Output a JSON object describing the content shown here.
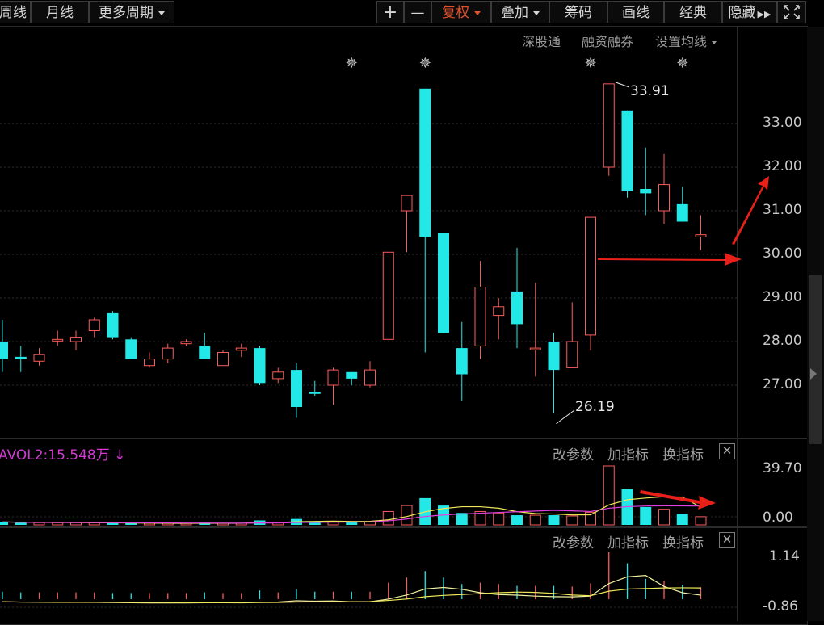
{
  "toolbar": {
    "left_tabs": [
      "周线",
      "月线",
      "更多周期"
    ],
    "zoom_in": "+",
    "zoom_out": "—",
    "buttons": [
      "复权",
      "叠加",
      "筹码",
      "画线",
      "经典",
      "隐藏"
    ]
  },
  "subnav": {
    "items": [
      "深股通",
      "融资融券",
      "设置均线"
    ]
  },
  "price_axis": {
    "ticks": [
      "33.00",
      "32.00",
      "31.00",
      "30.00",
      "29.00",
      "28.00",
      "27.00"
    ]
  },
  "annotations": {
    "high": "33.91",
    "low": "26.19"
  },
  "volume_panel": {
    "label": "AVOL2:15.548万",
    "arrow": "↓",
    "actions": [
      "改参数",
      "加指标",
      "换指标"
    ],
    "close": "✕",
    "axis": [
      "39.70",
      "0.00"
    ]
  },
  "indicator_panel": {
    "actions": [
      "改参数",
      "加指标",
      "换指标"
    ],
    "close": "✕",
    "axis": [
      "1.14",
      "-0.86"
    ]
  },
  "colors": {
    "up": "#ff5a5a",
    "down": "#22e8e8",
    "arrow": "#e8201a",
    "vol_line": "#f0e85a",
    "vol_line2": "#e040e0"
  },
  "chart_data": {
    "type": "candlestick",
    "price_range": [
      26.0,
      34.0
    ],
    "markers": [
      19,
      23,
      32,
      37
    ],
    "candles": [
      {
        "o": 28.0,
        "h": 28.5,
        "l": 27.3,
        "c": 27.6
      },
      {
        "o": 27.65,
        "h": 27.9,
        "l": 27.3,
        "c": 27.6
      },
      {
        "o": 27.55,
        "h": 27.85,
        "l": 27.45,
        "c": 27.7
      },
      {
        "o": 28.05,
        "h": 28.25,
        "l": 27.9,
        "c": 28.05
      },
      {
        "o": 28.0,
        "h": 28.25,
        "l": 27.8,
        "c": 28.1
      },
      {
        "o": 28.25,
        "h": 28.55,
        "l": 28.1,
        "c": 28.5
      },
      {
        "o": 28.65,
        "h": 28.7,
        "l": 28.05,
        "c": 28.1
      },
      {
        "o": 28.05,
        "h": 28.1,
        "l": 27.6,
        "c": 27.6
      },
      {
        "o": 27.45,
        "h": 27.75,
        "l": 27.4,
        "c": 27.6
      },
      {
        "o": 27.6,
        "h": 27.95,
        "l": 27.5,
        "c": 27.85
      },
      {
        "o": 27.95,
        "h": 28.05,
        "l": 27.9,
        "c": 28.0
      },
      {
        "o": 27.9,
        "h": 28.2,
        "l": 27.6,
        "c": 27.6
      },
      {
        "o": 27.45,
        "h": 27.8,
        "l": 27.45,
        "c": 27.75
      },
      {
        "o": 27.8,
        "h": 27.95,
        "l": 27.65,
        "c": 27.85
      },
      {
        "o": 27.85,
        "h": 27.9,
        "l": 27.0,
        "c": 27.05
      },
      {
        "o": 27.15,
        "h": 27.4,
        "l": 27.05,
        "c": 27.3
      },
      {
        "o": 27.35,
        "h": 27.5,
        "l": 26.25,
        "c": 26.5
      },
      {
        "o": 26.85,
        "h": 27.1,
        "l": 26.75,
        "c": 26.8
      },
      {
        "o": 27.0,
        "h": 27.4,
        "l": 26.55,
        "c": 27.35
      },
      {
        "o": 27.3,
        "h": 27.3,
        "l": 27.0,
        "c": 27.15
      },
      {
        "o": 27.0,
        "h": 27.55,
        "l": 26.95,
        "c": 27.35
      },
      {
        "o": 28.05,
        "h": 30.05,
        "l": 28.05,
        "c": 30.05
      },
      {
        "o": 31.0,
        "h": 31.35,
        "l": 30.05,
        "c": 31.35
      },
      {
        "o": 33.8,
        "h": 33.8,
        "l": 27.75,
        "c": 30.4
      },
      {
        "o": 30.5,
        "h": 30.5,
        "l": 28.2,
        "c": 28.2
      },
      {
        "o": 27.85,
        "h": 28.45,
        "l": 26.65,
        "c": 27.25
      },
      {
        "o": 27.9,
        "h": 29.85,
        "l": 27.6,
        "c": 29.25
      },
      {
        "o": 28.6,
        "h": 29.0,
        "l": 28.05,
        "c": 28.8
      },
      {
        "o": 29.15,
        "h": 30.15,
        "l": 27.85,
        "c": 28.4
      },
      {
        "o": 27.85,
        "h": 29.35,
        "l": 27.2,
        "c": 27.85
      },
      {
        "o": 28.0,
        "h": 28.2,
        "l": 26.35,
        "c": 27.35
      },
      {
        "o": 27.4,
        "h": 28.9,
        "l": 27.4,
        "c": 28.0
      },
      {
        "o": 28.15,
        "h": 30.85,
        "l": 27.8,
        "c": 30.85
      },
      {
        "o": 32.0,
        "h": 33.91,
        "l": 31.8,
        "c": 33.91
      },
      {
        "o": 33.3,
        "h": 33.3,
        "l": 31.3,
        "c": 31.45
      },
      {
        "o": 31.5,
        "h": 32.45,
        "l": 30.9,
        "c": 31.4
      },
      {
        "o": 31.0,
        "h": 32.3,
        "l": 30.7,
        "c": 31.6
      },
      {
        "o": 31.15,
        "h": 31.55,
        "l": 30.75,
        "c": 30.75
      },
      {
        "o": 30.4,
        "h": 30.9,
        "l": 30.1,
        "c": 30.45
      }
    ],
    "volume": {
      "axis_max": 39.7,
      "values": [
        2.0,
        1.5,
        1.5,
        1.5,
        1.5,
        1.5,
        1.0,
        1.0,
        1.0,
        1.0,
        1.0,
        1.5,
        1.0,
        1.0,
        3.0,
        1.5,
        4.0,
        2.0,
        2.0,
        2.0,
        2.0,
        9.0,
        13.0,
        18.0,
        13.0,
        8.0,
        9.0,
        8.0,
        6.5,
        6.5,
        6.5,
        6.0,
        8.5,
        39.7,
        24.0,
        12.0,
        10.5,
        7.5,
        5.5
      ]
    }
  }
}
